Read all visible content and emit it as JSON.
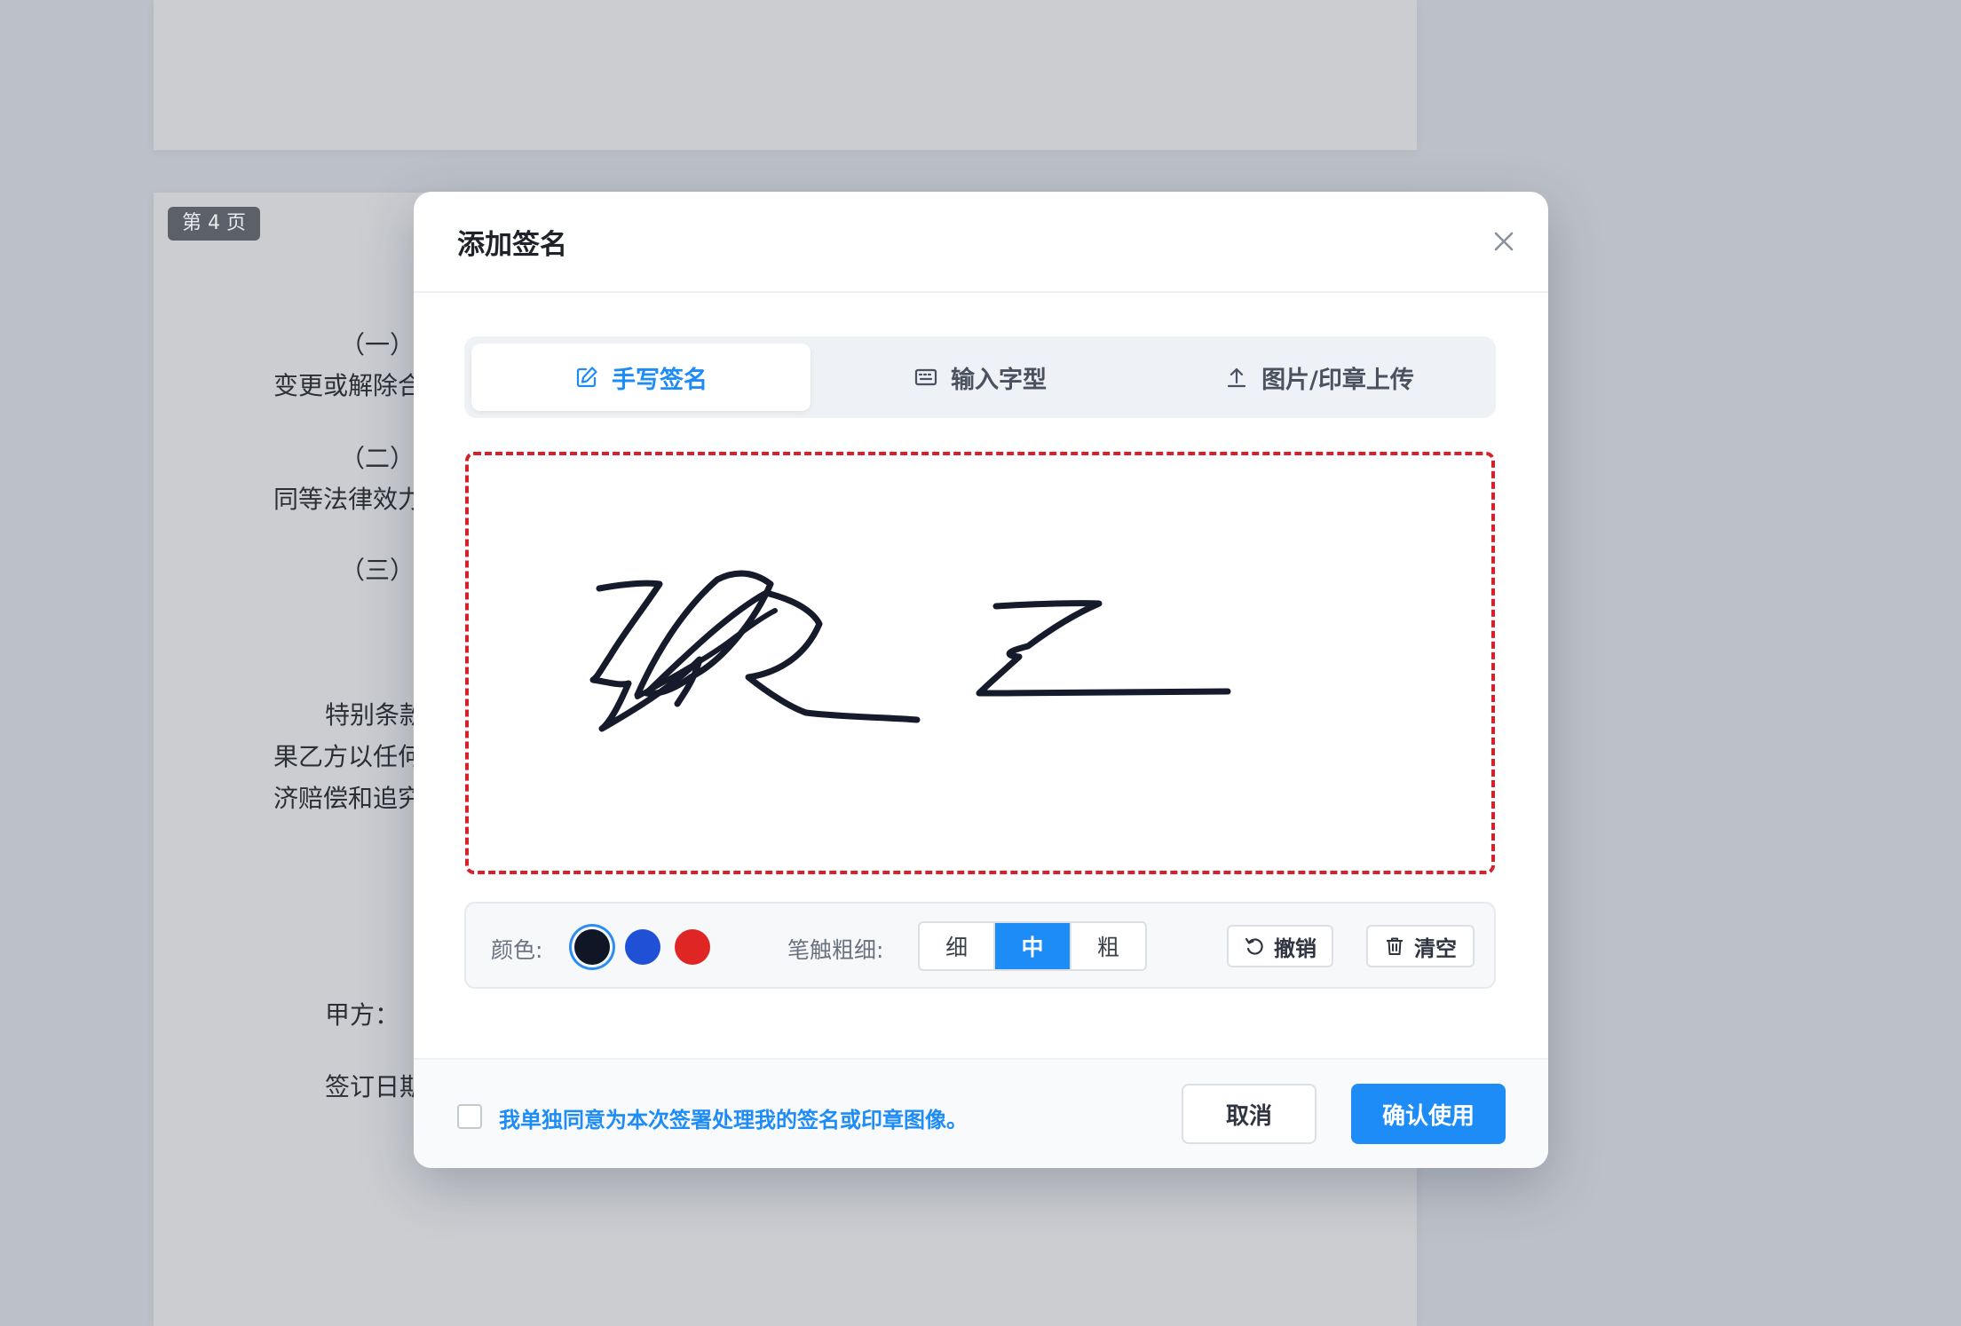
{
  "document": {
    "page_badge": "第 4 页",
    "lines": [
      "（一）本",
      "变更或解除合",
      "（二）本",
      "同等法律效力",
      "（三）其",
      "特别条款",
      "果乙方以任何",
      "济赔偿和追究",
      "甲方：",
      "签订日期"
    ]
  },
  "modal": {
    "title": "添加签名",
    "tabs": [
      {
        "label": "手写签名",
        "icon": "edit-icon",
        "active": true
      },
      {
        "label": "输入字型",
        "icon": "keyboard-icon",
        "active": false
      },
      {
        "label": "图片/印章上传",
        "icon": "upload-icon",
        "active": false
      }
    ],
    "signature": {
      "color": "#151b2b",
      "border_color": "#d6202a"
    },
    "toolbar": {
      "color_label": "颜色:",
      "colors": [
        "#0f1626",
        "#1f50d6",
        "#e02525"
      ],
      "selected_color": "#0f1626",
      "thickness_label": "笔触粗细:",
      "thickness_options": [
        "细",
        "中",
        "粗"
      ],
      "selected_thickness": "中",
      "undo_label": "撤销",
      "clear_label": "清空"
    },
    "footer": {
      "consent_text": "我单独同意为本次签署处理我的签名或印章图像。",
      "consent_checked": false,
      "cancel_label": "取消",
      "confirm_label": "确认使用"
    },
    "accent_color": "#1e8cf7"
  }
}
